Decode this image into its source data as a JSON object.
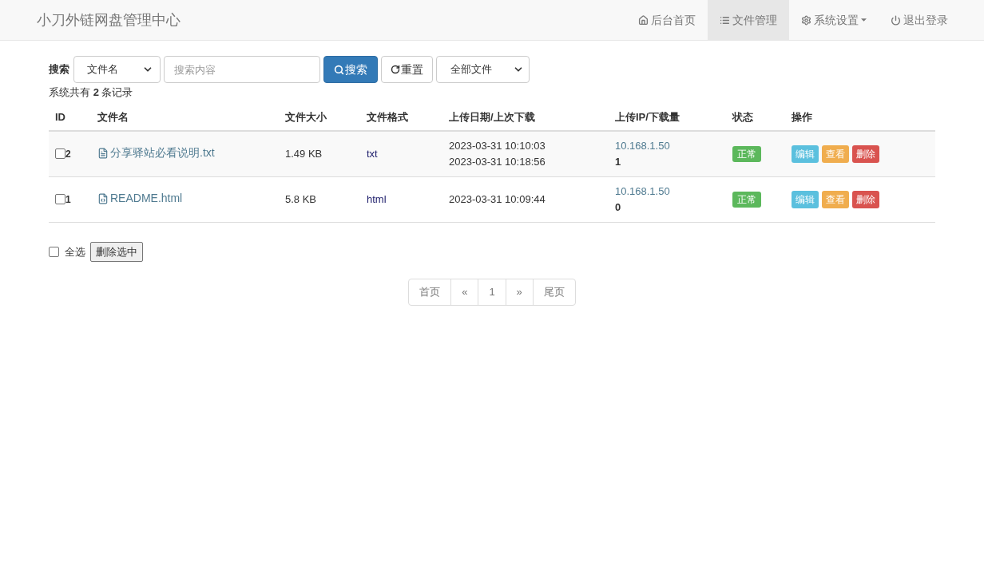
{
  "navbar": {
    "brand": "小刀外链网盘管理中心",
    "items": [
      {
        "label": "后台首页",
        "kind": "home",
        "selected": false,
        "dropdown": false
      },
      {
        "label": "文件管理",
        "kind": "list",
        "selected": true,
        "dropdown": false
      },
      {
        "label": "系统设置",
        "kind": "gear",
        "selected": false,
        "dropdown": true
      },
      {
        "label": "退出登录",
        "kind": "power",
        "selected": false,
        "dropdown": false
      }
    ]
  },
  "search": {
    "label": "搜索",
    "field_select": "文件名",
    "placeholder": "搜索内容",
    "search_button": "搜索",
    "reset_button": "重置",
    "type_select": "全部文件"
  },
  "record_count": "系统共有 **2** 条记录",
  "table": {
    "columns": [
      "ID",
      "文件名",
      "文件大小",
      "文件格式",
      "上传日期/上次下载",
      "上传IP/下载量",
      "状态",
      "操作"
    ],
    "rows": [
      {
        "checked": false,
        "id": "2",
        "kind": "text",
        "name": "分享驿站必看说明.txt",
        "size": "1.49 KB",
        "format": "txt",
        "dates": [
          "2023-03-31 10:10:03",
          "2023-03-31 10:18:56"
        ],
        "ip": "10.168.1.50",
        "downloads": "1",
        "status": {
          "kind": "ok",
          "label": "正常"
        },
        "actions": [
          {
            "kind": "info",
            "label": "编辑"
          },
          {
            "kind": "warning",
            "label": "查看"
          },
          {
            "kind": "danger",
            "label": "删除"
          }
        ]
      },
      {
        "checked": false,
        "id": "1",
        "kind": "code",
        "name": "README.html",
        "size": "5.8 KB",
        "format": "html",
        "dates": [
          "2023-03-31 10:09:44"
        ],
        "ip": "10.168.1.50",
        "downloads": "0",
        "status": {
          "kind": "ok",
          "label": "正常"
        },
        "actions": [
          {
            "kind": "info",
            "label": "编辑"
          },
          {
            "kind": "warning",
            "label": "查看"
          },
          {
            "kind": "danger",
            "label": "删除"
          }
        ]
      }
    ]
  },
  "bulk": {
    "select_all_label": "全选",
    "select_all_checked": false,
    "delete_button": "删除选中"
  },
  "pagination": [
    {
      "label": "首页",
      "selected": false
    },
    {
      "label": "«",
      "selected": false
    },
    {
      "label": "1",
      "selected": false
    },
    {
      "label": "»",
      "selected": false
    },
    {
      "label": "尾页",
      "selected": false
    }
  ]
}
